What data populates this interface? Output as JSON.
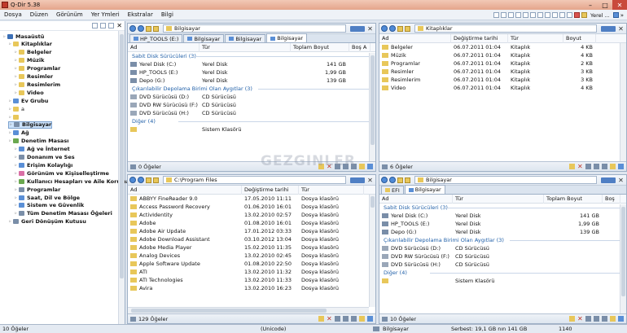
{
  "window": {
    "title": "Q-Dir 5.38",
    "minimize": "–",
    "maximize": "□",
    "close": "✕"
  },
  "menu": [
    "Dosya",
    "Düzen",
    "Görünüm",
    "Yer Ymleri",
    "Ekstralar",
    "Bilgi"
  ],
  "menu_right": {
    "label": "Yerel ...",
    "chevron": "»"
  },
  "tree": {
    "items": [
      {
        "label": "Masaüstü",
        "level": 0,
        "bold": true,
        "color": "#3b6fb6"
      },
      {
        "label": "Kitaplıklar",
        "level": 1,
        "bold": true,
        "color": "#e8c75a"
      },
      {
        "label": "Belgeler",
        "level": 2,
        "bold": true,
        "color": "#e8c75a"
      },
      {
        "label": "Müzik",
        "level": 2,
        "bold": true,
        "color": "#e8c75a"
      },
      {
        "label": "Programlar",
        "level": 2,
        "bold": true,
        "color": "#e8c75a"
      },
      {
        "label": "Resimler",
        "level": 2,
        "bold": true,
        "color": "#e8c75a"
      },
      {
        "label": "Resimlerim",
        "level": 2,
        "bold": true,
        "color": "#e8c75a"
      },
      {
        "label": "Video",
        "level": 2,
        "bold": true,
        "color": "#e8c75a"
      },
      {
        "label": "Ev Grubu",
        "level": 1,
        "bold": true,
        "color": "#5a8fd6"
      },
      {
        "label": "a",
        "level": 1,
        "bold": false,
        "color": "#e8c75a"
      },
      {
        "label": "",
        "level": 1,
        "bold": false,
        "color": "#e8c75a"
      },
      {
        "label": "Bilgisayar",
        "level": 1,
        "bold": true,
        "color": "#7a8ea8",
        "selected": true
      },
      {
        "label": "Ağ",
        "level": 1,
        "bold": true,
        "color": "#5a8fd6"
      },
      {
        "label": "Denetim Masası",
        "level": 1,
        "bold": true,
        "color": "#6aa84f"
      },
      {
        "label": "Ağ ve İnternet",
        "level": 2,
        "bold": true,
        "color": "#5a8fd6"
      },
      {
        "label": "Donanım ve Ses",
        "level": 2,
        "bold": true,
        "color": "#7a8ea8"
      },
      {
        "label": "Erişim Kolaylığı",
        "level": 2,
        "bold": true,
        "color": "#5a8fd6"
      },
      {
        "label": "Görünüm ve Kişiselleştirme",
        "level": 2,
        "bold": true,
        "color": "#d96fa5"
      },
      {
        "label": "Kullanıcı Hesapları ve Aile Koruması",
        "level": 2,
        "bold": true,
        "color": "#6aa84f"
      },
      {
        "label": "Programlar",
        "level": 2,
        "bold": true,
        "color": "#7a8ea8"
      },
      {
        "label": "Saat, Dil ve Bölge",
        "level": 2,
        "bold": true,
        "color": "#5a8fd6"
      },
      {
        "label": "Sistem ve Güvenlik",
        "level": 2,
        "bold": true,
        "color": "#5a8fd6"
      },
      {
        "label": "Tüm Denetim Masası Öğeleri",
        "level": 2,
        "bold": true,
        "color": "#7a8ea8"
      },
      {
        "label": "Geri Dönüşüm Kutusu",
        "level": 1,
        "bold": true,
        "color": "#7a8ea8"
      }
    ]
  },
  "pane_tl": {
    "address": "Bilgisayar",
    "tabs": [
      "HP_TOOLS (E:)",
      "Bilgisayar",
      "Bilgisayar",
      "Bilgisayar"
    ],
    "active_tab": 3,
    "columns": [
      "Ad",
      "Tür",
      "Toplam Boyut",
      "Boş A"
    ],
    "groups": [
      {
        "title": "Sabit Disk Sürücüleri (3)",
        "rows": [
          [
            "Yerel Disk (C:)",
            "Yerel Disk",
            "141 GB"
          ],
          [
            "HP_TOOLS (E:)",
            "Yerel Disk",
            "1,99 GB"
          ],
          [
            "Depo (G:)",
            "Yerel Disk",
            "139 GB"
          ]
        ]
      },
      {
        "title": "Çıkarılabilir Depolama Birimi Olan Aygıtlar (3)",
        "rows": [
          [
            "DVD Sürücüsü (D:)",
            "CD Sürücüsü",
            ""
          ],
          [
            "DVD RW Sürücüsü (F:)",
            "CD Sürücüsü",
            ""
          ],
          [
            "DVD Sürücüsü (H:)",
            "CD Sürücüsü",
            ""
          ]
        ]
      },
      {
        "title": "Diğer (4)",
        "rows": [
          [
            "",
            "Sistem Klasörü",
            ""
          ]
        ]
      }
    ],
    "status": "0 Öğeler"
  },
  "pane_tr": {
    "address": "Kitaplıklar",
    "columns": [
      "Ad",
      "Değiştirme tarihi",
      "Tür",
      "Boyut"
    ],
    "rows": [
      [
        "Belgeler",
        "06.07.2011 01:04",
        "Kitaplık",
        "4 KB"
      ],
      [
        "Müzik",
        "06.07.2011 01:04",
        "Kitaplık",
        "4 KB"
      ],
      [
        "Programlar",
        "06.07.2011 01:04",
        "Kitaplık",
        "2 KB"
      ],
      [
        "Resimler",
        "06.07.2011 01:04",
        "Kitaplık",
        "3 KB"
      ],
      [
        "Resimlerim",
        "06.07.2011 01:04",
        "Kitaplık",
        "3 KB"
      ],
      [
        "Video",
        "06.07.2011 01:04",
        "Kitaplık",
        "4 KB"
      ]
    ],
    "status": "6 Öğeler"
  },
  "pane_bl": {
    "address": "C:\\Program Files",
    "columns": [
      "Ad",
      "Değiştirme tarihi",
      "Tür"
    ],
    "rows": [
      [
        "ABBYY FineReader 9.0",
        "17.05.2010 11:11",
        "Dosya klasörü"
      ],
      [
        "Access Password Recovery",
        "01.06.2010 16:01",
        "Dosya klasörü"
      ],
      [
        "ActivIdentity",
        "13.02.2010 02:57",
        "Dosya klasörü"
      ],
      [
        "Adobe",
        "01.08.2010 16:01",
        "Dosya klasörü"
      ],
      [
        "Adobe Air Update",
        "17.01.2012 03:33",
        "Dosya klasörü"
      ],
      [
        "Adobe Download Assistant",
        "03.10.2012 13:04",
        "Dosya klasörü"
      ],
      [
        "Adobe Media Player",
        "15.02.2010 11:35",
        "Dosya klasörü"
      ],
      [
        "Analog Devices",
        "13.02.2010 02:45",
        "Dosya klasörü"
      ],
      [
        "Apple Software Update",
        "01.08.2010 22:50",
        "Dosya klasörü"
      ],
      [
        "ATI",
        "13.02.2010 11:32",
        "Dosya klasörü"
      ],
      [
        "ATI Technologies",
        "13.02.2010 11:33",
        "Dosya klasörü"
      ],
      [
        "Avira",
        "13.02.2010 16:23",
        "Dosya klasörü"
      ]
    ],
    "status": "129 Öğeler"
  },
  "pane_br": {
    "address": "Bilgisayar",
    "tabs": [
      "EFI",
      "Bilgisayar"
    ],
    "active_tab": 1,
    "columns": [
      "Ad",
      "Tür",
      "Toplam Boyut",
      "Boş"
    ],
    "groups": [
      {
        "title": "Sabit Disk Sürücüleri (3)",
        "rows": [
          [
            "Yerel Disk (C:)",
            "Yerel Disk",
            "141 GB"
          ],
          [
            "HP_TOOLS (E:)",
            "Yerel Disk",
            "1,99 GB"
          ],
          [
            "Depo (G:)",
            "Yerel Disk",
            "139 GB"
          ]
        ]
      },
      {
        "title": "Çıkarılabilir Depolama Birimi Olan Aygıtlar (3)",
        "rows": [
          [
            "DVD Sürücüsü (D:)",
            "CD Sürücüsü",
            ""
          ],
          [
            "DVD RW Sürücüsü (F:)",
            "CD Sürücüsü",
            ""
          ],
          [
            "DVD Sürücüsü (H:)",
            "CD Sürücüsü",
            ""
          ]
        ]
      },
      {
        "title": "Diğer (4)",
        "rows": [
          [
            "",
            "Sistem Klasörü",
            ""
          ]
        ]
      }
    ],
    "status": "10 Öğeler"
  },
  "statusbar": {
    "items": "10 Öğeler",
    "encoding": "(Unicode)",
    "location": "Bilgisayar",
    "free": "Serbest: 19,1 GB nın 141 GB",
    "number": "1140"
  },
  "watermark": "GEZGINLER"
}
